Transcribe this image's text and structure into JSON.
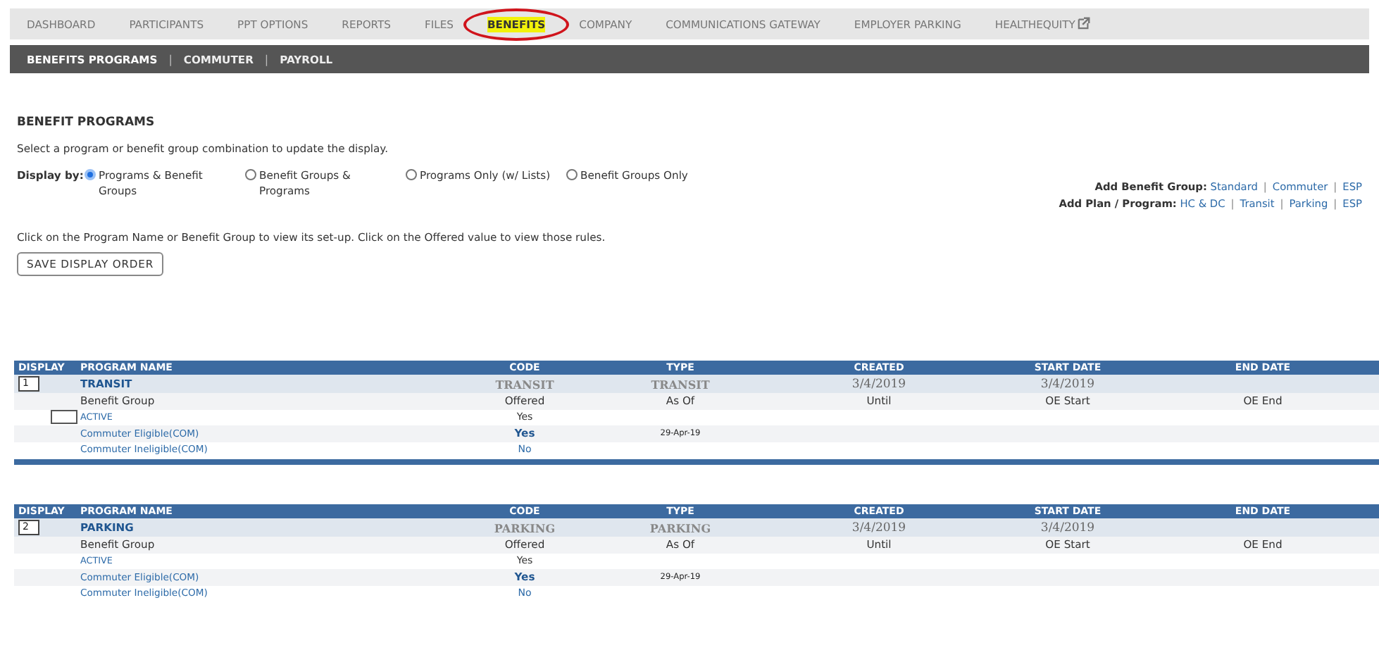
{
  "nav": [
    {
      "label": "DASHBOARD",
      "selected": false,
      "circled": false,
      "external": false
    },
    {
      "label": "PARTICIPANTS",
      "selected": false,
      "circled": false,
      "external": false
    },
    {
      "label": "PPT OPTIONS",
      "selected": false,
      "circled": false,
      "external": false
    },
    {
      "label": "REPORTS",
      "selected": false,
      "circled": false,
      "external": false
    },
    {
      "label": "FILES",
      "selected": false,
      "circled": false,
      "external": false
    },
    {
      "label": "BENEFITS",
      "selected": true,
      "circled": true,
      "external": false
    },
    {
      "label": "COMPANY",
      "selected": false,
      "circled": false,
      "external": false
    },
    {
      "label": "COMMUNICATIONS GATEWAY",
      "selected": false,
      "circled": false,
      "external": false
    },
    {
      "label": "EMPLOYER PARKING",
      "selected": false,
      "circled": false,
      "external": false
    },
    {
      "label": "HEALTHEQUITY",
      "selected": false,
      "circled": false,
      "external": true
    }
  ],
  "subnav": [
    {
      "label": "BENEFITS PROGRAMS",
      "selected": true
    },
    {
      "label": "COMMUTER",
      "selected": false
    },
    {
      "label": "PAYROLL",
      "selected": false
    }
  ],
  "separator": "|",
  "title": "BENEFIT PROGRAMS",
  "description": "Select a program or benefit group combination to update the display.",
  "display_by": {
    "label": "Display by:",
    "options": [
      {
        "label": "Programs & Benefit Groups",
        "selected": true
      },
      {
        "label": "Benefit Groups & Programs",
        "selected": false
      },
      {
        "label": "Programs Only (w/ Lists)",
        "selected": false
      },
      {
        "label": "Benefit Groups Only",
        "selected": false
      }
    ]
  },
  "add_links": [
    {
      "label": "Add Benefit Group:",
      "links": [
        "Standard",
        "Commuter",
        "ESP"
      ]
    },
    {
      "label": "Add Plan / Program:",
      "links": [
        "HC & DC",
        "Transit",
        "Parking",
        "ESP"
      ]
    }
  ],
  "instructions": "Click on the Program Name or Benefit Group to view its set-up. Click on the Offered value to view those rules.",
  "save_button": "SAVE DISPLAY ORDER",
  "tables": [
    {
      "columns": [
        "DISPLAY",
        "PROGRAM NAME",
        "CODE",
        "TYPE",
        "CREATED",
        "START DATE",
        "END DATE"
      ],
      "program": {
        "order": "1",
        "name": "TRANSIT",
        "code": "TRANSIT",
        "type": "TRANSIT",
        "created": "3/4/2019",
        "start_date": "3/4/2019"
      },
      "group_header": [
        "Benefit Group",
        "Offered",
        "As Of",
        "Until",
        "OE Start",
        "OE End"
      ],
      "rows": [
        {
          "name": "ACTIVE",
          "offered": "Yes",
          "kind": "plain",
          "order_field": true
        },
        {
          "name": "Commuter Eligible(COM)",
          "offered": "Yes",
          "kind": "bold-link",
          "as_of": "29-Apr-19",
          "order_field": false
        },
        {
          "name": "Commuter Ineligible(COM)",
          "offered": "No",
          "kind": "link",
          "order_field": false
        }
      ],
      "footer_bar": true
    },
    {
      "columns": [
        "DISPLAY",
        "PROGRAM NAME",
        "CODE",
        "TYPE",
        "CREATED",
        "START DATE",
        "END DATE"
      ],
      "program": {
        "order": "2",
        "name": "PARKING",
        "code": "PARKING",
        "type": "PARKING",
        "created": "3/4/2019",
        "start_date": "3/4/2019"
      },
      "group_header": [
        "Benefit Group",
        "Offered",
        "As Of",
        "Until",
        "OE Start",
        "OE End"
      ],
      "rows": [
        {
          "name": "ACTIVE",
          "offered": "Yes",
          "kind": "plain",
          "order_field": false
        },
        {
          "name": "Commuter Eligible(COM)",
          "offered": "Yes",
          "kind": "bold-link",
          "as_of": "29-Apr-19",
          "order_field": false
        },
        {
          "name": "Commuter Ineligible(COM)",
          "offered": "No",
          "kind": "link",
          "order_field": false
        }
      ],
      "footer_bar": false
    }
  ]
}
